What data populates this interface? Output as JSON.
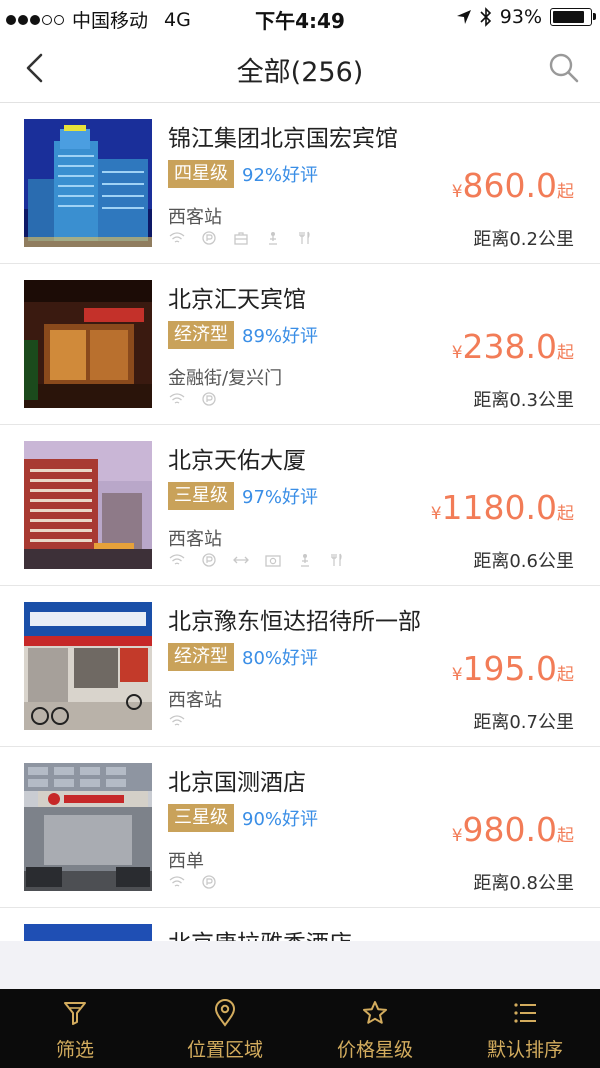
{
  "status_bar": {
    "carrier": "中国移动",
    "network": "4G",
    "time": "下午4:49",
    "battery": "93%",
    "battery_level": 0.93
  },
  "nav": {
    "title": "全部(256)"
  },
  "hotels": [
    {
      "name": "锦江集团北京国宏宾馆",
      "star": "四星级",
      "rating": "92%好评",
      "area": "西客站",
      "price_symbol": "¥",
      "price": "860.0",
      "price_suffix": "起",
      "distance": "距离0.2公里",
      "amenities": [
        "wifi-icon",
        "parking-icon",
        "luggage-icon",
        "fitness-icon",
        "restaurant-icon"
      ]
    },
    {
      "name": "北京汇天宾馆",
      "star": "经济型",
      "rating": "89%好评",
      "area": "金融街/复兴门",
      "price_symbol": "¥",
      "price": "238.0",
      "price_suffix": "起",
      "distance": "距离0.3公里",
      "amenities": [
        "wifi-icon",
        "parking-icon"
      ]
    },
    {
      "name": "北京天佑大厦",
      "star": "三星级",
      "rating": "97%好评",
      "area": "西客站",
      "price_symbol": "¥",
      "price": "1180.0",
      "price_suffix": "起",
      "distance": "距离0.6公里",
      "amenities": [
        "wifi-icon",
        "parking-icon",
        "transfer-icon",
        "camera-icon",
        "fitness-icon",
        "restaurant-icon"
      ]
    },
    {
      "name": "北京豫东恒达招待所一部",
      "star": "经济型",
      "rating": "80%好评",
      "area": "西客站",
      "price_symbol": "¥",
      "price": "195.0",
      "price_suffix": "起",
      "distance": "距离0.7公里",
      "amenities": [
        "wifi-icon"
      ]
    },
    {
      "name": "北京国测酒店",
      "star": "三星级",
      "rating": "90%好评",
      "area": "西单",
      "price_symbol": "¥",
      "price": "980.0",
      "price_suffix": "起",
      "distance": "距离0.8公里",
      "amenities": [
        "wifi-icon",
        "parking-icon"
      ]
    },
    {
      "name": "北京唐拉雅秀酒店"
    }
  ],
  "tabs": [
    {
      "label": "筛选",
      "icon": "filter-icon"
    },
    {
      "label": "位置区域",
      "icon": "location-pin-icon"
    },
    {
      "label": "价格星级",
      "icon": "star-icon"
    },
    {
      "label": "默认排序",
      "icon": "sort-list-icon"
    }
  ],
  "colors": {
    "star_tag": "#c9a25a",
    "rating": "#3a8ee6",
    "price": "#f27c57",
    "tab_bar_bg": "#0b0b0b",
    "tab_text": "#d3ac5e"
  }
}
